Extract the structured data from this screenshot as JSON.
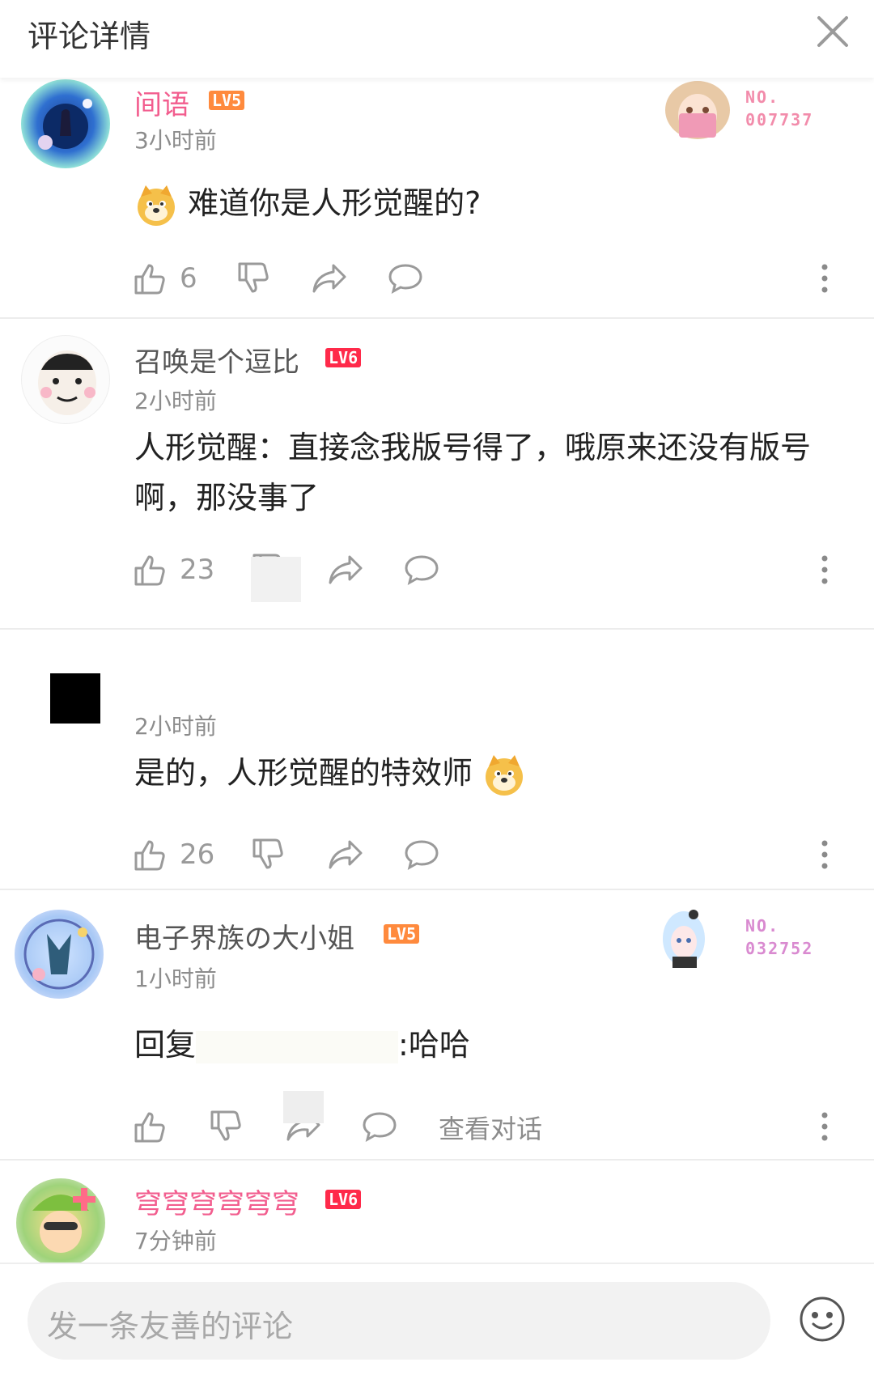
{
  "header": {
    "title": "评论详情"
  },
  "comments": [
    {
      "name": "间语",
      "level": "LV5",
      "time": "3小时前",
      "text": "难道你是人形觉醒的?",
      "likes": "6",
      "badge": "NO.\n007737"
    },
    {
      "name": "召唤是个逗比",
      "level": "LV6",
      "time": "2小时前",
      "text": "人形觉醒：直接念我版号得了，哦原来还没有版号啊，那没事了",
      "likes": "23"
    },
    {
      "name": "",
      "time": "2小时前",
      "text": "是的，人形觉醒的特效师",
      "likes": "26"
    },
    {
      "name": "电子界族の大小姐",
      "level": "LV5",
      "time": "1小时前",
      "reply_prefix": "回复",
      "text": ":哈哈",
      "view_dialog": "查看对话",
      "badge": "NO.\n032752"
    },
    {
      "name": "穹穹穹穹穹穹",
      "level": "LV6",
      "time": "7分钟前"
    }
  ],
  "bottom": {
    "placeholder": "发一条友善的评论"
  },
  "colors": {
    "vip_name": "#f25d8e",
    "lv5": "#ff8a3d",
    "lv6": "#ff2a4a",
    "icon_gray": "#9a9a9a"
  }
}
